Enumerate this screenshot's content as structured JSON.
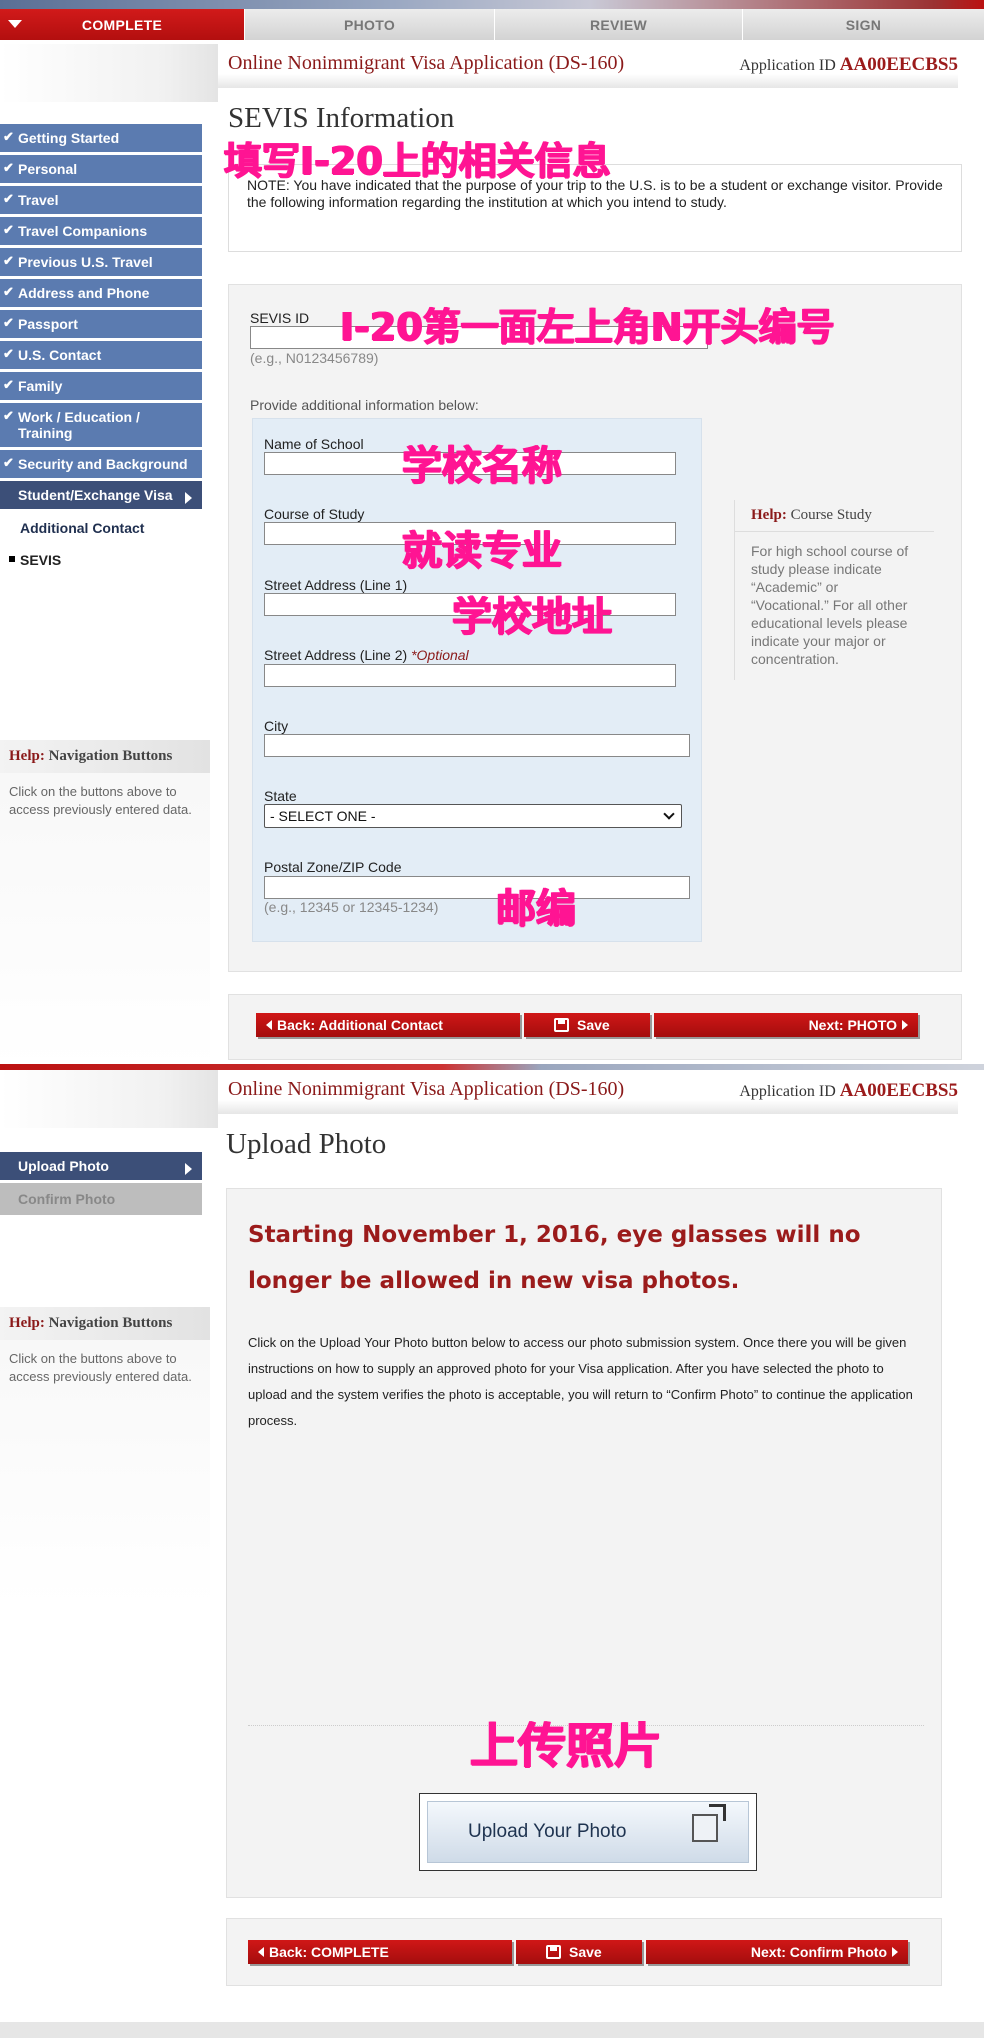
{
  "tabs": {
    "complete": "COMPLETE",
    "photo": "PHOTO",
    "review": "REVIEW",
    "sign": "SIGN"
  },
  "header": {
    "title": "Online Nonimmigrant Visa Application (DS-160)",
    "app_id_label": "Application ID",
    "app_id": "AA00EECBS5"
  },
  "sidebar": {
    "items": [
      "Getting Started",
      "Personal",
      "Travel",
      "Travel Companions",
      "Previous U.S. Travel",
      "Address and Phone",
      "Passport",
      "U.S. Contact",
      "Family",
      "Work / Education / Training",
      "Security and Background"
    ],
    "current": "Student/Exchange Visa",
    "sub_item": "Additional Contact",
    "active_sub": "SEVIS",
    "check": "✔"
  },
  "help_nav": {
    "title_prefix": "Help:",
    "title": "Navigation Buttons",
    "body": "Click on the buttons above to access previously entered data."
  },
  "sevis": {
    "title": "SEVIS Information",
    "note": "NOTE: You have indicated that the purpose of your trip to the U.S. is to be a student or exchange visitor. Provide the following information regarding the institution at which you intend to study.",
    "sevis_id_label": "SEVIS ID",
    "sevis_id_hint": "(e.g., N0123456789)",
    "additional_label": "Provide additional information below:",
    "school_label": "Name of School",
    "course_label": "Course of Study",
    "street1_label": "Street Address (Line 1)",
    "street2_label": "Street Address (Line 2)",
    "optional": "*Optional",
    "city_label": "City",
    "state_label": "State",
    "state_value": "- SELECT ONE -",
    "zip_label": "Postal Zone/ZIP Code",
    "zip_hint": "(e.g., 12345 or 12345-1234)",
    "help_prefix": "Help:",
    "help_title": "Course Study",
    "help_body": "For high school course of study please indicate “Academic” or “Vocational.” For all other educational levels please indicate your major or concentration."
  },
  "sevis_buttons": {
    "back": "Back: Additional Contact",
    "save": "Save",
    "next": "Next: PHOTO"
  },
  "captions": {
    "fill_i20": "填写I-20上的相关信息",
    "sevis_id": "I-20第一面左上角N开头编号",
    "school": "学校名称",
    "major": "就读专业",
    "address": "学校地址",
    "zip": "邮编",
    "upload": "上传照片"
  },
  "upload": {
    "sidebar_current": "Upload Photo",
    "sidebar_next": "Confirm Photo",
    "title": "Upload Photo",
    "warning_line1": "Starting November 1, 2016, eye glasses will no",
    "warning_line2": "longer be allowed in new visa photos.",
    "body": "Click on the Upload Your Photo button below to access our photo submission system. Once there you will be given instructions on how to supply an approved photo for your Visa application. After you have selected the photo to upload and the system verifies the photo is acceptable, you will return to “Confirm Photo” to continue the application process.",
    "button": "Upload Your Photo"
  },
  "upload_buttons": {
    "back": "Back: COMPLETE",
    "save": "Save",
    "next": "Next: Confirm Photo"
  }
}
